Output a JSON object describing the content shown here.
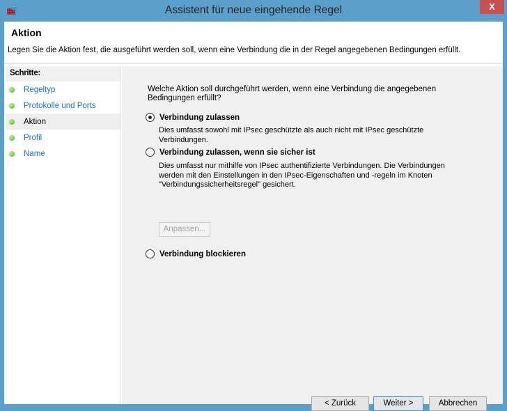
{
  "window": {
    "title": "Assistent für neue eingehende Regel",
    "close_label": "X"
  },
  "header": {
    "title": "Aktion",
    "description": "Legen Sie die Aktion fest, die ausgeführt werden soll, wenn eine Verbindung die in der Regel angegebenen Bedingungen erfüllt."
  },
  "sidebar": {
    "heading": "Schritte:",
    "items": [
      {
        "label": "Regeltyp"
      },
      {
        "label": "Protokolle und Ports"
      },
      {
        "label": "Aktion"
      },
      {
        "label": "Profil"
      },
      {
        "label": "Name"
      }
    ]
  },
  "main": {
    "question": "Welche Aktion soll durchgeführt werden, wenn eine Verbindung die angegebenen Bedingungen erfüllt?",
    "options": [
      {
        "label": "Verbindung zulassen",
        "description": "Dies umfasst sowohl mit IPsec geschützte als auch nicht mit IPsec geschützte Verbindungen.",
        "selected": true
      },
      {
        "label": "Verbindung zulassen, wenn sie sicher ist",
        "description": "Dies umfasst nur mithilfe von IPsec authentifizierte Verbindungen. Die Verbindungen werden mit den Einstellungen in den IPsec-Eigenschaften und -regeln im Knoten \"Verbindungssicherheitsregel\" gesichert.",
        "selected": false
      },
      {
        "label": "Verbindung blockieren",
        "selected": false
      }
    ],
    "customize_label": "Anpassen..."
  },
  "footer": {
    "back": "< Zurück",
    "next": "Weiter >",
    "cancel": "Abbrechen"
  }
}
